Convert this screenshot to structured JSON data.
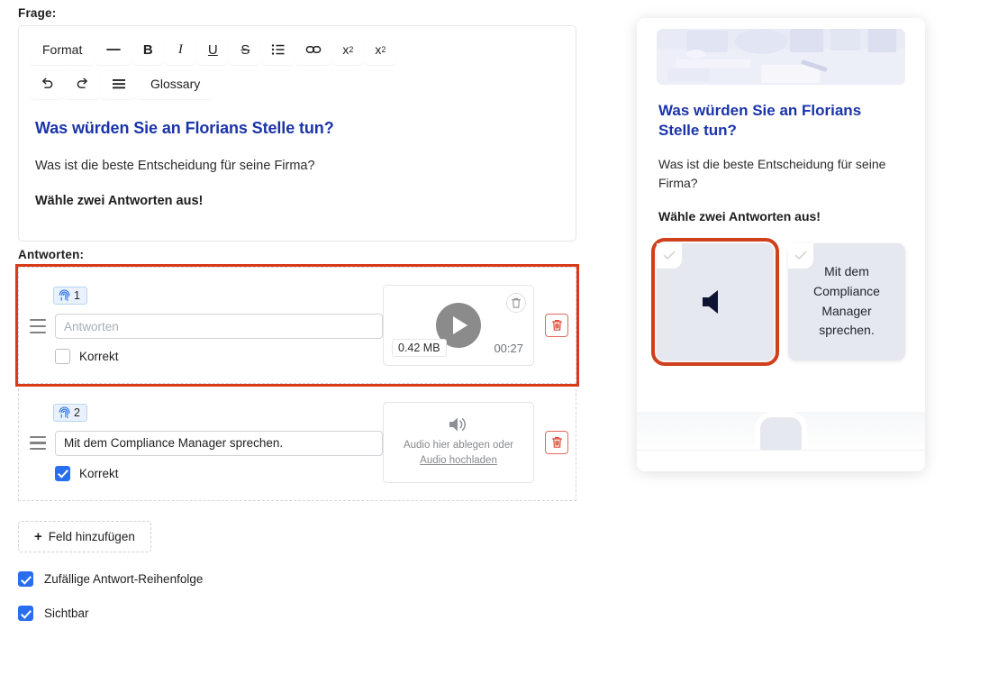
{
  "editor": {
    "question_label": "Frage:",
    "answers_label": "Antworten:",
    "toolbar": {
      "row1": [
        {
          "name": "format-dropdown",
          "label": "Format",
          "kind": "text"
        },
        {
          "name": "horizontal-rule-icon",
          "label": "—",
          "kind": "icon"
        },
        {
          "name": "bold-icon",
          "label": "B",
          "kind": "bold"
        },
        {
          "name": "italic-icon",
          "label": "I",
          "kind": "italic"
        },
        {
          "name": "underline-icon",
          "label": "U",
          "kind": "underline"
        },
        {
          "name": "strikethrough-icon",
          "label": "S",
          "kind": "strike"
        },
        {
          "name": "bulleted-list-icon",
          "label": "",
          "kind": "list"
        },
        {
          "name": "link-icon",
          "label": "",
          "kind": "link"
        },
        {
          "name": "superscript-icon",
          "label": "x",
          "kind": "sup",
          "script": "2"
        },
        {
          "name": "subscript-icon",
          "label": "x",
          "kind": "sub",
          "script": "2"
        }
      ],
      "row2": [
        {
          "name": "undo-icon",
          "label": "",
          "kind": "undo"
        },
        {
          "name": "redo-icon",
          "label": "",
          "kind": "redo"
        },
        {
          "name": "align-icon",
          "label": "",
          "kind": "align"
        },
        {
          "name": "glossary-button",
          "label": "Glossary",
          "kind": "text"
        }
      ]
    },
    "content": {
      "heading": "Was würden Sie an Florians Stelle tun?",
      "paragraph": "Was ist die beste Entscheidung für seine Firma?",
      "bold_line": "Wähle zwei Antworten aus!"
    },
    "answers": [
      {
        "index": "1",
        "badge_icon": "fingerprint-icon",
        "value": "",
        "placeholder": "Antworten",
        "correct_label": "Korrekt",
        "correct": false,
        "highlighted": true,
        "media": {
          "type": "player",
          "size": "0.42 MB",
          "duration": "00:27"
        }
      },
      {
        "index": "2",
        "badge_icon": "fingerprint-icon",
        "value": "Mit dem Compliance Manager sprechen.",
        "placeholder": "Antworten",
        "correct_label": "Korrekt",
        "correct": true,
        "highlighted": false,
        "media": {
          "type": "dropzone",
          "drop_text": "Audio hier ablegen oder",
          "upload_link": "Audio hochladen"
        }
      }
    ],
    "add_field_label": "Feld hinzufügen",
    "add_field_plus": "+",
    "options": [
      {
        "name": "random-answer-order",
        "label": "Zufällige Antwort-Reihenfolge",
        "checked": true
      },
      {
        "name": "visible",
        "label": "Sichtbar",
        "checked": true
      }
    ]
  },
  "preview": {
    "heading": "Was würden Sie an Florians Stelle tun?",
    "paragraph": "Was ist die beste Entscheidung für seine Firma?",
    "bold_line": "Wähle zwei Antworten aus!",
    "cards": [
      {
        "name": "preview-answer-card-audio",
        "kind": "audio",
        "text": "",
        "highlighted": true,
        "checked": true
      },
      {
        "name": "preview-answer-card-text",
        "kind": "text",
        "text": "Mit dem Compliance Manager sprechen.",
        "highlighted": false,
        "checked": true
      }
    ]
  },
  "colors": {
    "heading_blue": "#1a34a8",
    "checkbox_blue": "#2a6ef0",
    "highlight_red": "#d93a18",
    "trash_red": "#e06a5b"
  }
}
